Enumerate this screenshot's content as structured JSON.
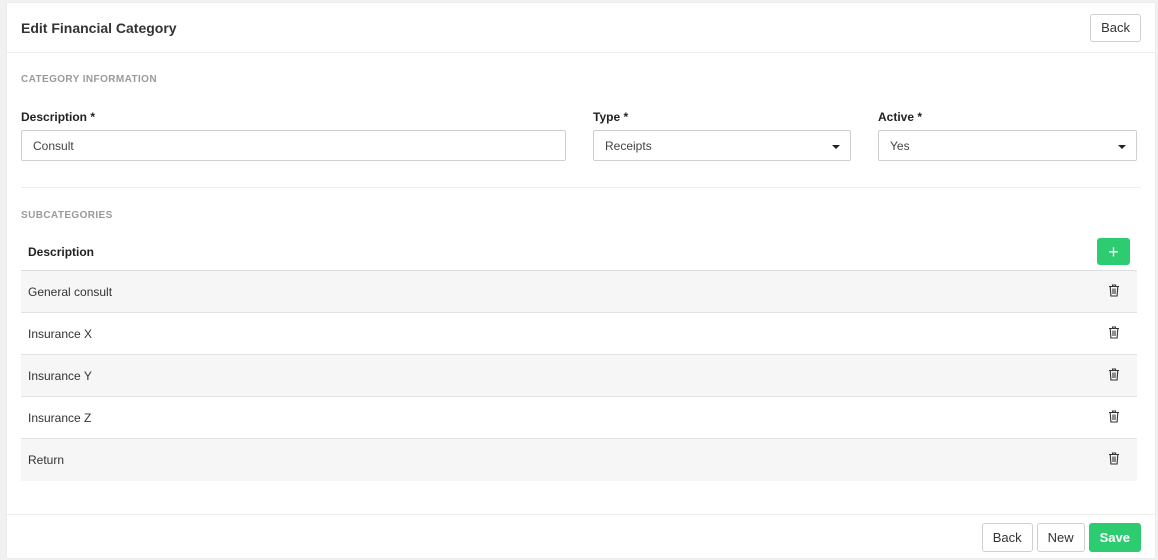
{
  "header": {
    "title": "Edit Financial Category",
    "back_label": "Back"
  },
  "category_info": {
    "section_label": "CATEGORY INFORMATION",
    "description": {
      "label": "Description *",
      "value": "Consult"
    },
    "type": {
      "label": "Type *",
      "value": "Receipts"
    },
    "active": {
      "label": "Active *",
      "value": "Yes"
    }
  },
  "subcategories": {
    "section_label": "SUBCATEGORIES",
    "column_header": "Description",
    "add_label": "+",
    "rows": [
      {
        "description": "General consult"
      },
      {
        "description": "Insurance X"
      },
      {
        "description": "Insurance Y"
      },
      {
        "description": "Insurance Z"
      },
      {
        "description": "Return"
      }
    ]
  },
  "footer": {
    "back_label": "Back",
    "new_label": "New",
    "save_label": "Save"
  },
  "colors": {
    "success": "#2ecc71",
    "border": "#cfcfcf"
  },
  "icons": {
    "delete": "trash-icon",
    "add": "plus-icon",
    "dropdown": "caret-down-icon"
  }
}
